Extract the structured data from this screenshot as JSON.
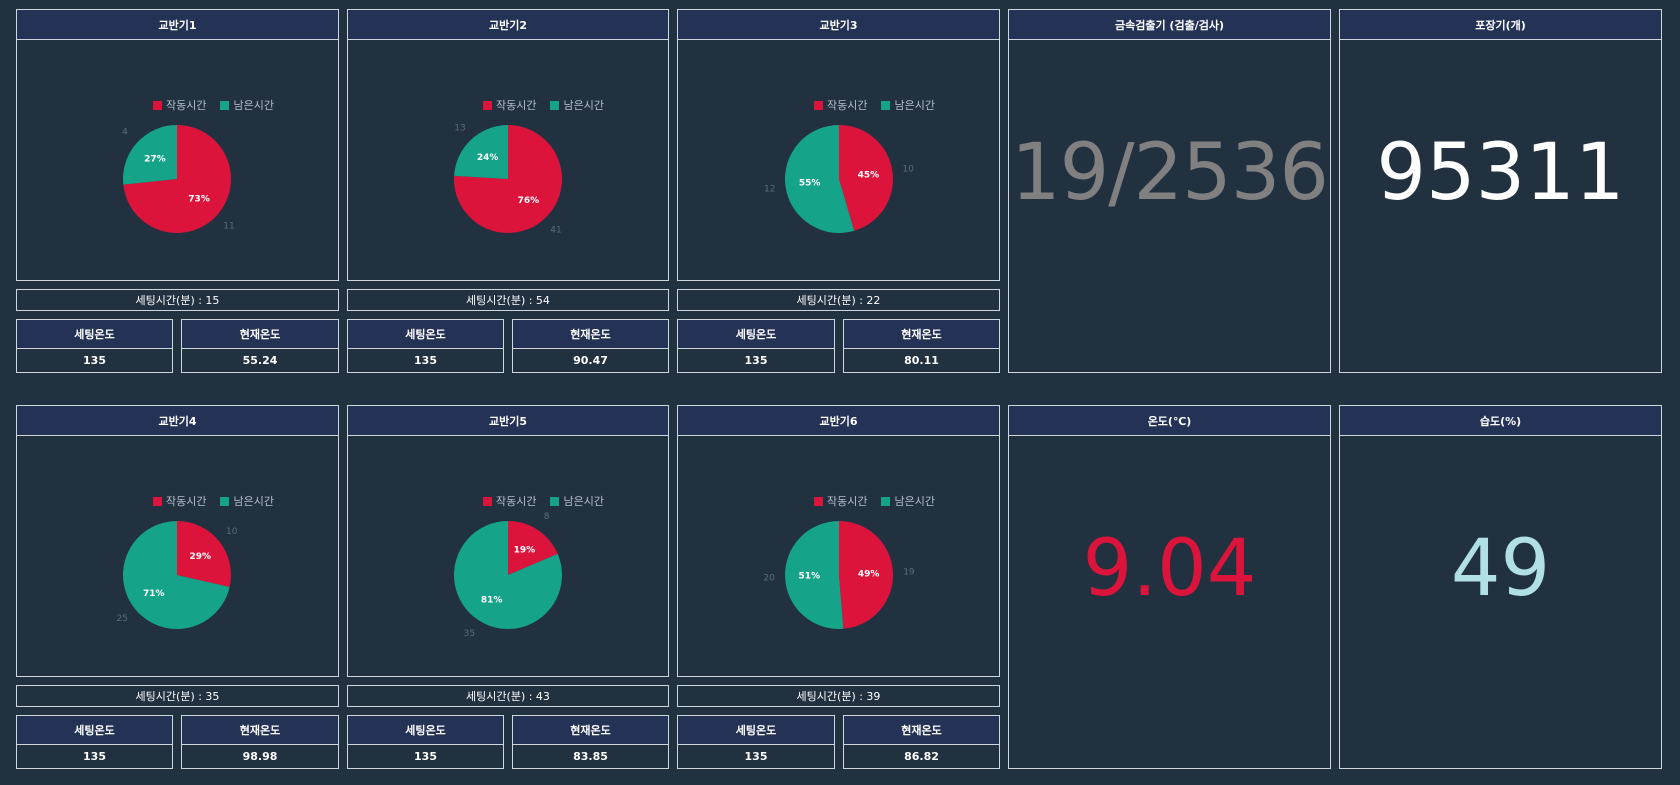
{
  "colors": {
    "run": "#dc143c",
    "remain": "#15a38a",
    "metal": "#808080",
    "packing": "#ffffff",
    "temp": "#dc143c",
    "humidity": "#b0e0e6"
  },
  "mixers": [
    {
      "title": "교반기1",
      "legend_run": "작동시간",
      "legend_remain": "남은시간",
      "run": 11,
      "remain": 4,
      "run_pct": "73%",
      "remain_pct": "27%",
      "run_label": "11",
      "remain_label": "4",
      "setting_time": "세팅시간(분) : 15",
      "set_temp_label": "세팅온도",
      "set_temp": "135",
      "cur_temp_label": "현재온도",
      "cur_temp": "55.24"
    },
    {
      "title": "교반기2",
      "legend_run": "작동시간",
      "legend_remain": "남은시간",
      "run": 41,
      "remain": 13,
      "run_pct": "76%",
      "remain_pct": "24%",
      "run_label": "41",
      "remain_label": "13",
      "setting_time": "세팅시간(분) : 54",
      "set_temp_label": "세팅온도",
      "set_temp": "135",
      "cur_temp_label": "현재온도",
      "cur_temp": "90.47"
    },
    {
      "title": "교반기3",
      "legend_run": "작동시간",
      "legend_remain": "남은시간",
      "run": 10,
      "remain": 12,
      "run_pct": "45%",
      "remain_pct": "55%",
      "run_label": "10",
      "remain_label": "12",
      "setting_time": "세팅시간(분) : 22",
      "set_temp_label": "세팅온도",
      "set_temp": "135",
      "cur_temp_label": "현재온도",
      "cur_temp": "80.11"
    },
    {
      "title": "교반기4",
      "legend_run": "작동시간",
      "legend_remain": "남은시간",
      "run": 10,
      "remain": 25,
      "run_pct": "29%",
      "remain_pct": "71%",
      "run_label": "10",
      "remain_label": "25",
      "setting_time": "세팅시간(분) : 35",
      "set_temp_label": "세팅온도",
      "set_temp": "135",
      "cur_temp_label": "현재온도",
      "cur_temp": "98.98"
    },
    {
      "title": "교반기5",
      "legend_run": "작동시간",
      "legend_remain": "남은시간",
      "run": 8,
      "remain": 35,
      "run_pct": "19%",
      "remain_pct": "81%",
      "run_label": "8",
      "remain_label": "35",
      "setting_time": "세팅시간(분) : 43",
      "set_temp_label": "세팅온도",
      "set_temp": "135",
      "cur_temp_label": "현재온도",
      "cur_temp": "83.85"
    },
    {
      "title": "교반기6",
      "legend_run": "작동시간",
      "legend_remain": "남은시간",
      "run": 19,
      "remain": 20,
      "run_pct": "49%",
      "remain_pct": "51%",
      "run_label": "19",
      "remain_label": "20",
      "setting_time": "세팅시간(분) : 39",
      "set_temp_label": "세팅온도",
      "set_temp": "135",
      "cur_temp_label": "현재온도",
      "cur_temp": "86.82"
    }
  ],
  "metal_detector": {
    "title": "금속검출기 (검출/검사)",
    "value": "19/2536"
  },
  "packing": {
    "title": "포장기(개)",
    "value": "95311"
  },
  "temperature": {
    "title": "온도(℃)",
    "value": "9.04"
  },
  "humidity": {
    "title": "습도(%)",
    "value": "49"
  }
}
